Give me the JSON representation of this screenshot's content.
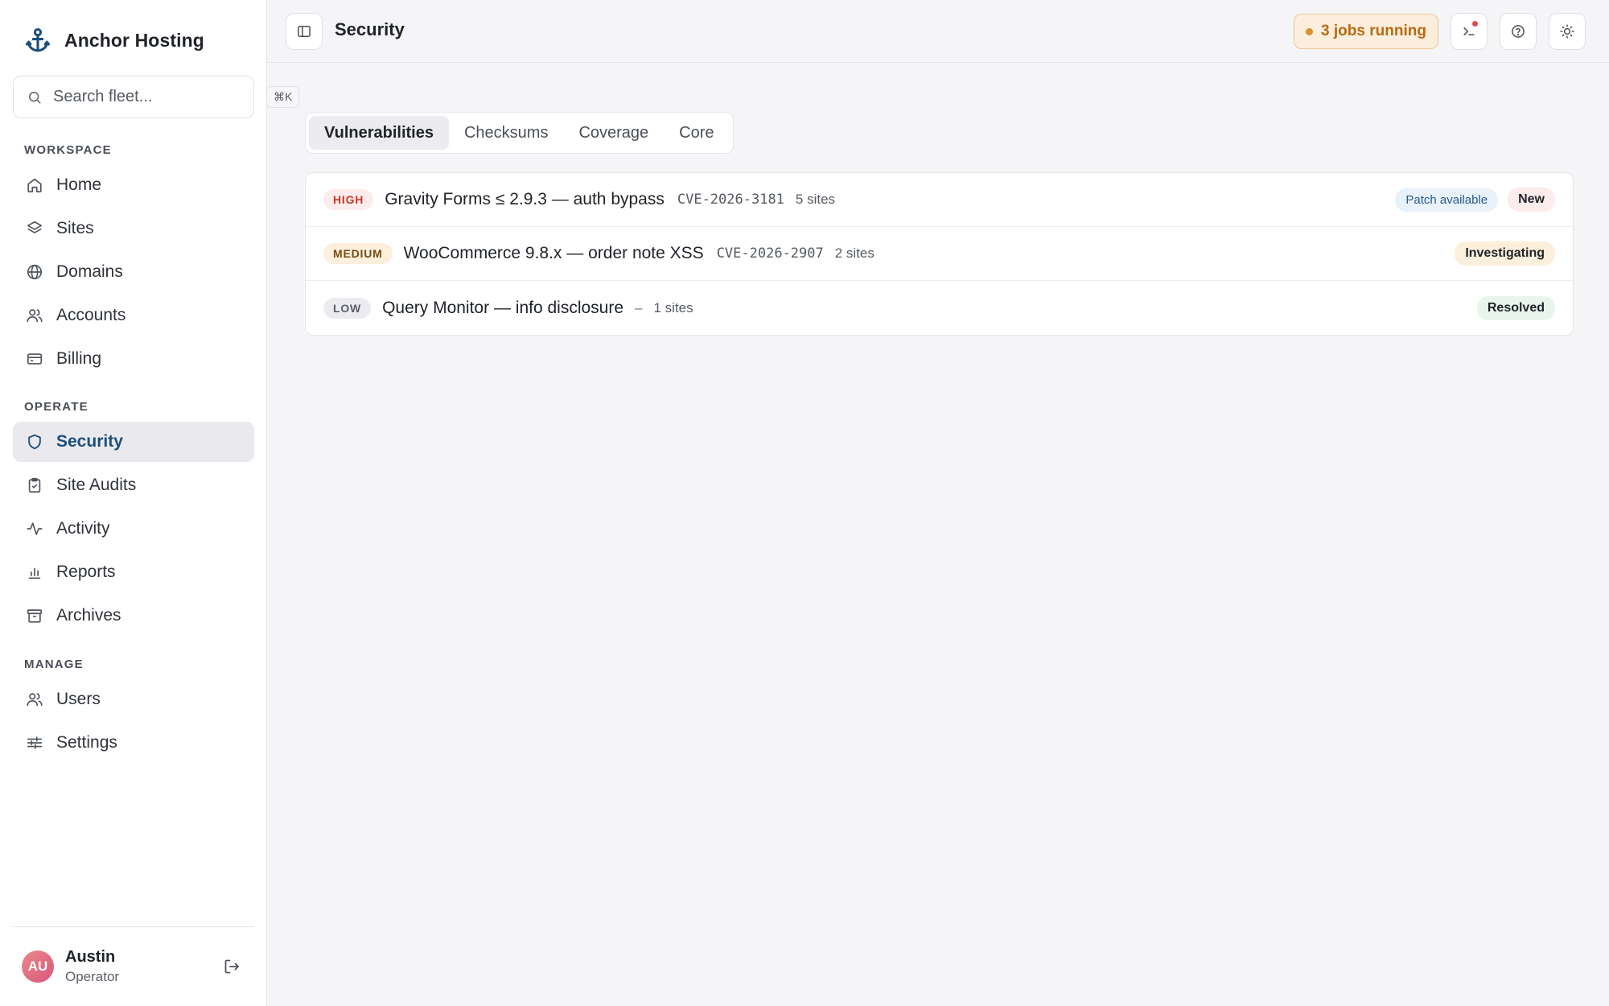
{
  "brand": {
    "name": "Anchor Hosting"
  },
  "search": {
    "placeholder": "Search fleet...",
    "shortcut": "⌘K"
  },
  "sidebar": {
    "sections": [
      {
        "title": "WORKSPACE",
        "items": [
          {
            "label": "Home",
            "icon": "home-icon"
          },
          {
            "label": "Sites",
            "icon": "layers-icon"
          },
          {
            "label": "Domains",
            "icon": "globe-icon"
          },
          {
            "label": "Accounts",
            "icon": "users-icon"
          },
          {
            "label": "Billing",
            "icon": "credit-card-icon"
          }
        ]
      },
      {
        "title": "OPERATE",
        "items": [
          {
            "label": "Security",
            "icon": "shield-icon",
            "active": true
          },
          {
            "label": "Site Audits",
            "icon": "clipboard-check-icon"
          },
          {
            "label": "Activity",
            "icon": "activity-icon"
          },
          {
            "label": "Reports",
            "icon": "bar-chart-icon"
          },
          {
            "label": "Archives",
            "icon": "archive-icon"
          }
        ]
      },
      {
        "title": "MANAGE",
        "items": [
          {
            "label": "Users",
            "icon": "users-icon"
          },
          {
            "label": "Settings",
            "icon": "sliders-icon"
          }
        ]
      }
    ]
  },
  "user": {
    "initials": "AU",
    "name": "Austin",
    "role": "Operator"
  },
  "header": {
    "title": "Security",
    "jobs_label": "3 jobs running"
  },
  "tabs": [
    {
      "label": "Vulnerabilities",
      "active": true
    },
    {
      "label": "Checksums"
    },
    {
      "label": "Coverage"
    },
    {
      "label": "Core"
    }
  ],
  "vulnerabilities": [
    {
      "severity": "HIGH",
      "title": "Gravity Forms ≤ 2.9.3 — auth bypass",
      "cve": "CVE-2026-3181",
      "sites": "5 sites",
      "patch": "Patch available",
      "status": "New"
    },
    {
      "severity": "MEDIUM",
      "title": "WooCommerce 9.8.x — order note XSS",
      "cve": "CVE-2026-2907",
      "sites": "2 sites",
      "status": "Investigating"
    },
    {
      "severity": "LOW",
      "title": "Query Monitor — info disclosure",
      "cve": "–",
      "sites": "1 sites",
      "status": "Resolved"
    }
  ],
  "colors": {
    "accent": "#1e4f7a",
    "high": "#c0392b",
    "warning": "#d4922e",
    "resolved": "#e7f5ec"
  }
}
